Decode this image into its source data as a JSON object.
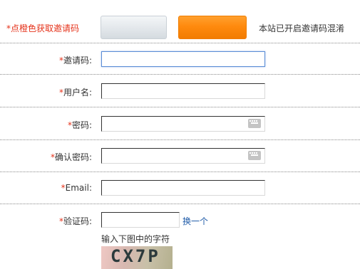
{
  "top": {
    "invite_label": "*点橙色获取邀请码",
    "notice": "本站已开启邀请码混淆"
  },
  "form": {
    "invite": {
      "star": "*",
      "label": "邀请码:",
      "value": ""
    },
    "username": {
      "star": "*",
      "label": "用户名:",
      "value": ""
    },
    "password": {
      "star": "*",
      "label": "密码:",
      "value": ""
    },
    "confirm": {
      "star": "*",
      "label": "确认密码:",
      "value": ""
    },
    "email": {
      "star": "*",
      "label": "Email:",
      "value": ""
    },
    "captcha": {
      "star": "*",
      "label": "验证码:",
      "value": "",
      "change_link": "换一个",
      "hint": "输入下图中的字符",
      "image_text": "CX7P"
    }
  },
  "icons": {
    "password_keyboard": "keyboard-icon",
    "confirm_keyboard": "keyboard-icon"
  },
  "colors": {
    "required": "#e5331b",
    "orange_button": "#ff8a0e",
    "link": "#1f5ba8",
    "focus_border": "#5b8dd6"
  }
}
